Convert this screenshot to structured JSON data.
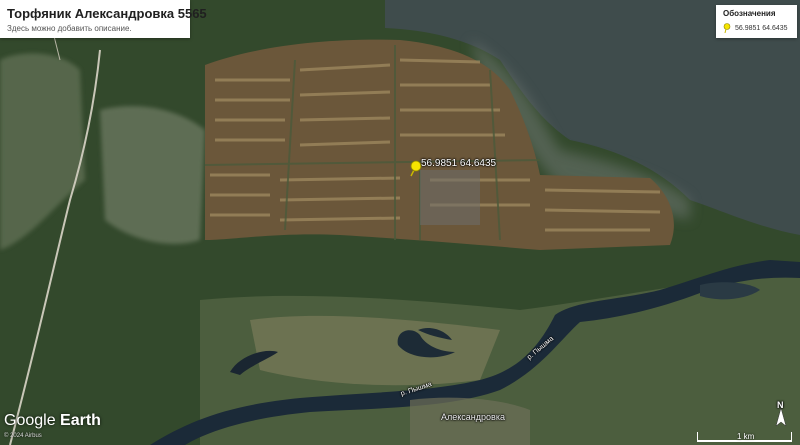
{
  "title_card": {
    "title": "Торфяник Александровка 5565",
    "subtitle": "Здесь можно добавить описание."
  },
  "legend": {
    "heading": "Обозначения",
    "item_label": "56.9851 64.6435",
    "item_icon": "yellow-pushpin-icon"
  },
  "placemark": {
    "label": "56.9851 64.6435",
    "icon": "yellow-pushpin-icon",
    "color": "#f5e400"
  },
  "map_labels": {
    "village": "Александровка",
    "river_1": "р. Пышма",
    "river_2": "р. Пышма"
  },
  "branding": {
    "logo_text_1": "Google",
    "logo_text_2": "Earth",
    "copyright": "© 2024 Airbus"
  },
  "scale_bar": {
    "label": "1 km"
  },
  "compass": {
    "label": "N"
  },
  "colors": {
    "forest": "#2f4a2a",
    "peat_bog": "#6f5a3c",
    "water": "#1b2b3a",
    "lake": "#3e4b4c",
    "pin": "#f5e400"
  }
}
